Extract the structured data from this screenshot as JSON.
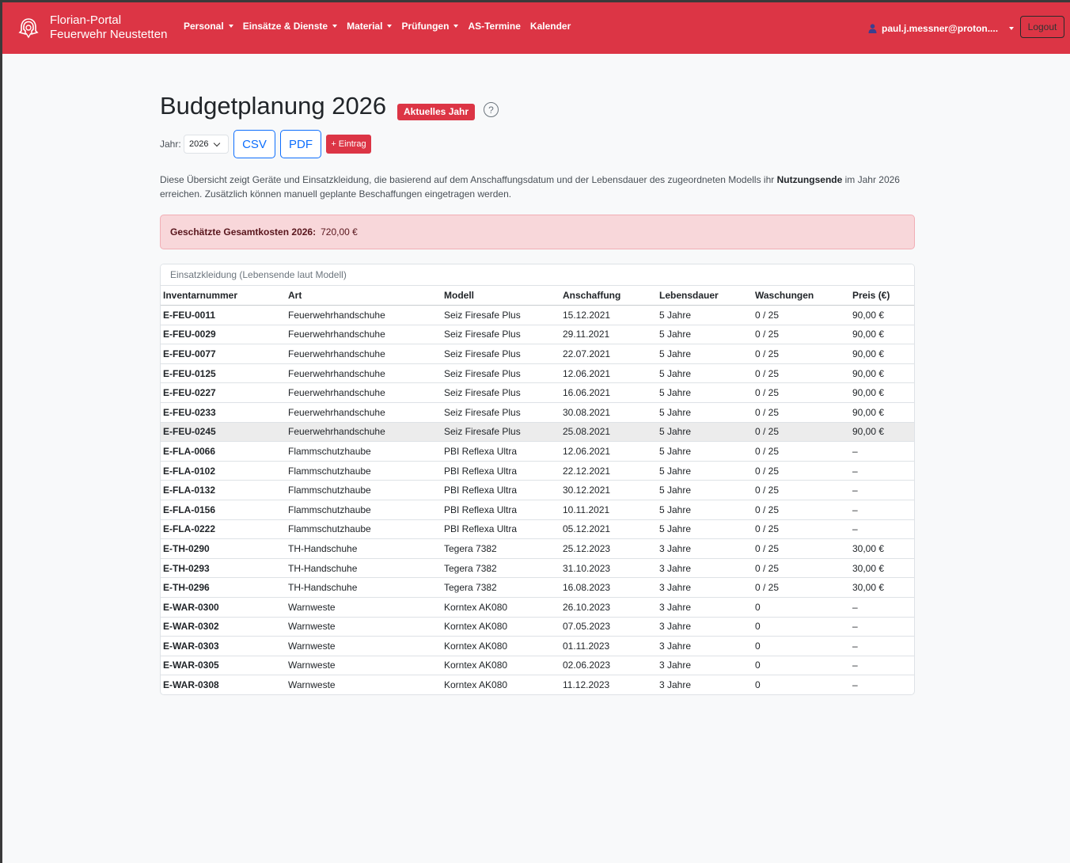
{
  "navbar": {
    "brand_line1": "Florian-Portal",
    "brand_line2": "Feuerwehr Neustetten",
    "menu": [
      {
        "label": "Personal"
      },
      {
        "label": "Einsätze & Dienste"
      },
      {
        "label": "Material"
      },
      {
        "label": "Prüfungen"
      },
      {
        "label": "AS-Termine"
      },
      {
        "label": "Kalender"
      }
    ],
    "user": "paul.j.messner@proton....",
    "logout": "Logout"
  },
  "page": {
    "title": "Budgetplanung 2026",
    "badge": "Aktuelles Jahr",
    "help": "?",
    "year_label": "Jahr:",
    "year_value": "2026",
    "csv": "CSV",
    "pdf": "PDF",
    "add": "+ Eintrag",
    "desc_part1": "Diese Übersicht zeigt Geräte und Einsatzkleidung, die basierend auf dem Anschaffungsdatum und der Lebensdauer des zugeordneten Modells ihr ",
    "desc_bold": "Nutzungsende",
    "desc_part2": " im Jahr 2026 erreichen. Zusätzlich können manuell geplante Beschaffungen eingetragen werden.",
    "total_label": "Geschätzte Gesamtkosten 2026:",
    "total_value": "720,00 €"
  },
  "table": {
    "header": "Einsatzkleidung (Lebensende laut Modell)",
    "columns": [
      "Inventarnummer",
      "Art",
      "Modell",
      "Anschaffung",
      "Lebensdauer",
      "Waschungen",
      "Preis (€)"
    ],
    "rows": [
      [
        "E-FEU-0011",
        "Feuerwehrhandschuhe",
        "Seiz Firesafe Plus",
        "15.12.2021",
        "5 Jahre",
        "0 / 25",
        "90,00 €"
      ],
      [
        "E-FEU-0029",
        "Feuerwehrhandschuhe",
        "Seiz Firesafe Plus",
        "29.11.2021",
        "5 Jahre",
        "0 / 25",
        "90,00 €"
      ],
      [
        "E-FEU-0077",
        "Feuerwehrhandschuhe",
        "Seiz Firesafe Plus",
        "22.07.2021",
        "5 Jahre",
        "0 / 25",
        "90,00 €"
      ],
      [
        "E-FEU-0125",
        "Feuerwehrhandschuhe",
        "Seiz Firesafe Plus",
        "12.06.2021",
        "5 Jahre",
        "0 / 25",
        "90,00 €"
      ],
      [
        "E-FEU-0227",
        "Feuerwehrhandschuhe",
        "Seiz Firesafe Plus",
        "16.06.2021",
        "5 Jahre",
        "0 / 25",
        "90,00 €"
      ],
      [
        "E-FEU-0233",
        "Feuerwehrhandschuhe",
        "Seiz Firesafe Plus",
        "30.08.2021",
        "5 Jahre",
        "0 / 25",
        "90,00 €"
      ],
      [
        "E-FEU-0245",
        "Feuerwehrhandschuhe",
        "Seiz Firesafe Plus",
        "25.08.2021",
        "5 Jahre",
        "0 / 25",
        "90,00 €"
      ],
      [
        "E-FLA-0066",
        "Flammschutzhaube",
        "PBI Reflexa Ultra",
        "12.06.2021",
        "5 Jahre",
        "0 / 25",
        "–"
      ],
      [
        "E-FLA-0102",
        "Flammschutzhaube",
        "PBI Reflexa Ultra",
        "22.12.2021",
        "5 Jahre",
        "0 / 25",
        "–"
      ],
      [
        "E-FLA-0132",
        "Flammschutzhaube",
        "PBI Reflexa Ultra",
        "30.12.2021",
        "5 Jahre",
        "0 / 25",
        "–"
      ],
      [
        "E-FLA-0156",
        "Flammschutzhaube",
        "PBI Reflexa Ultra",
        "10.11.2021",
        "5 Jahre",
        "0 / 25",
        "–"
      ],
      [
        "E-FLA-0222",
        "Flammschutzhaube",
        "PBI Reflexa Ultra",
        "05.12.2021",
        "5 Jahre",
        "0 / 25",
        "–"
      ],
      [
        "E-TH-0290",
        "TH-Handschuhe",
        "Tegera 7382",
        "25.12.2023",
        "3 Jahre",
        "0 / 25",
        "30,00 €"
      ],
      [
        "E-TH-0293",
        "TH-Handschuhe",
        "Tegera 7382",
        "31.10.2023",
        "3 Jahre",
        "0 / 25",
        "30,00 €"
      ],
      [
        "E-TH-0296",
        "TH-Handschuhe",
        "Tegera 7382",
        "16.08.2023",
        "3 Jahre",
        "0 / 25",
        "30,00 €"
      ],
      [
        "E-WAR-0300",
        "Warnweste",
        "Korntex AK080",
        "26.10.2023",
        "3 Jahre",
        "0",
        "–"
      ],
      [
        "E-WAR-0302",
        "Warnweste",
        "Korntex AK080",
        "07.05.2023",
        "3 Jahre",
        "0",
        "–"
      ],
      [
        "E-WAR-0303",
        "Warnweste",
        "Korntex AK080",
        "01.11.2023",
        "3 Jahre",
        "0",
        "–"
      ],
      [
        "E-WAR-0305",
        "Warnweste",
        "Korntex AK080",
        "02.06.2023",
        "3 Jahre",
        "0",
        "–"
      ],
      [
        "E-WAR-0308",
        "Warnweste",
        "Korntex AK080",
        "11.12.2023",
        "3 Jahre",
        "0",
        "–"
      ]
    ]
  },
  "colors": {
    "brand": "#dc3545",
    "link": "#0d6efd",
    "alert_bg": "#f8d7da"
  }
}
